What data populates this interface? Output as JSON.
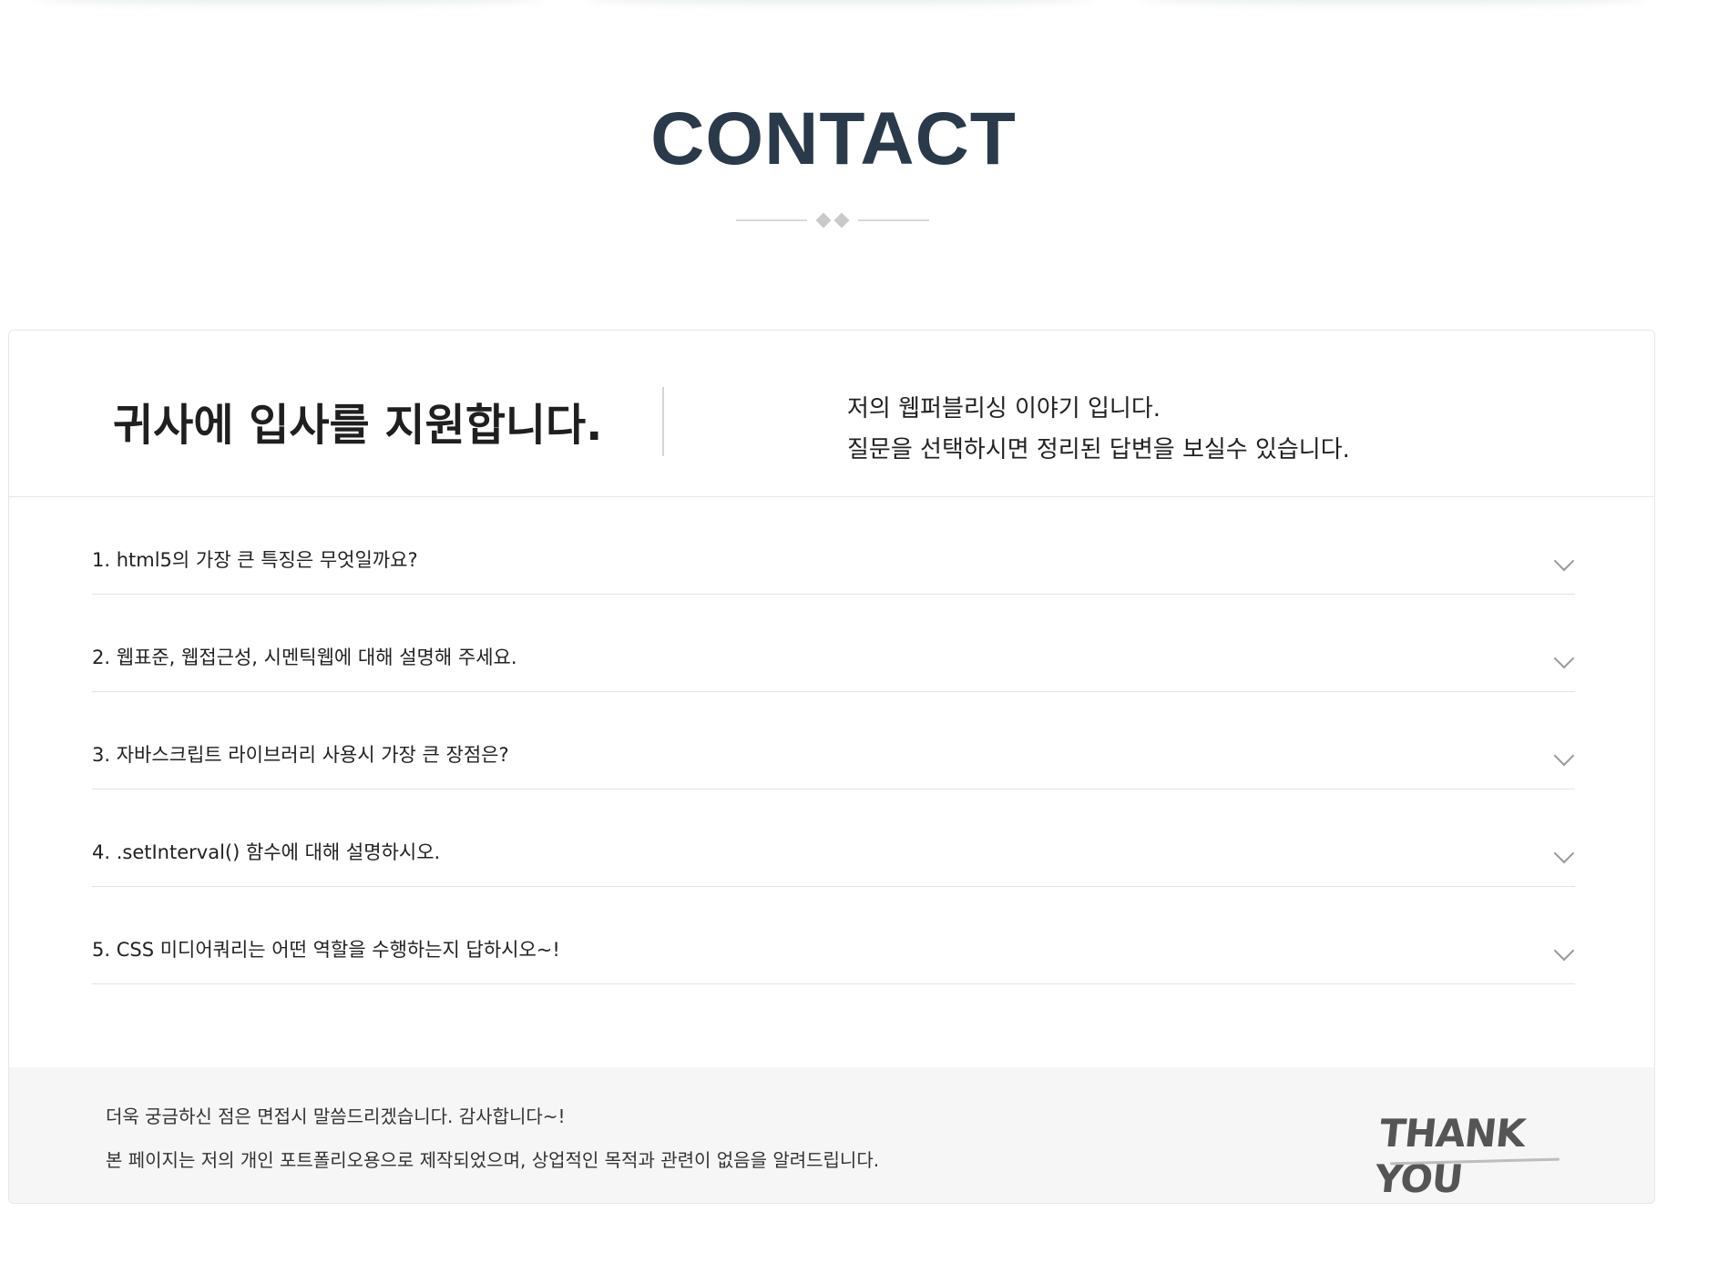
{
  "section": {
    "title": "CONTACT"
  },
  "card": {
    "headline": "귀사에 입사를 지원합니다.",
    "intro_lines": [
      "저의 웹퍼블리싱 이야기 입니다.",
      "질문을 선택하시면 정리된 답변을 보실수 있습니다."
    ]
  },
  "faq": [
    {
      "question": "1. html5의 가장 큰 특징은 무엇일까요?"
    },
    {
      "question": "2. 웹표준, 웹접근성, 시멘틱웹에 대해 설명해 주세요."
    },
    {
      "question": "3. 자바스크립트 라이브러리 사용시 가장 큰 장점은?"
    },
    {
      "question": "4. .setInterval() 함수에 대해 설명하시오."
    },
    {
      "question": "5. CSS 미디어쿼리는 어떤 역할을 수행하는지 답하시오~!"
    }
  ],
  "footer": {
    "line1": "더욱 궁금하신 점은 면접시 말씀드리겠습니다. 감사합니다~!",
    "line2": "본 페이지는 저의 개인 포트폴리오용으로 제작되었으며, 상업적인 목적과 관련이 없음을 알려드립니다.",
    "thank_you_logo": "THANK YOU"
  },
  "icons": {
    "accordion": "chevron-down-icon",
    "ornament": "diamond-divider-icon"
  },
  "colors": {
    "title": "#2b3a4a",
    "footer_bg": "#f6f6f6",
    "border": "#e6e6e6"
  }
}
